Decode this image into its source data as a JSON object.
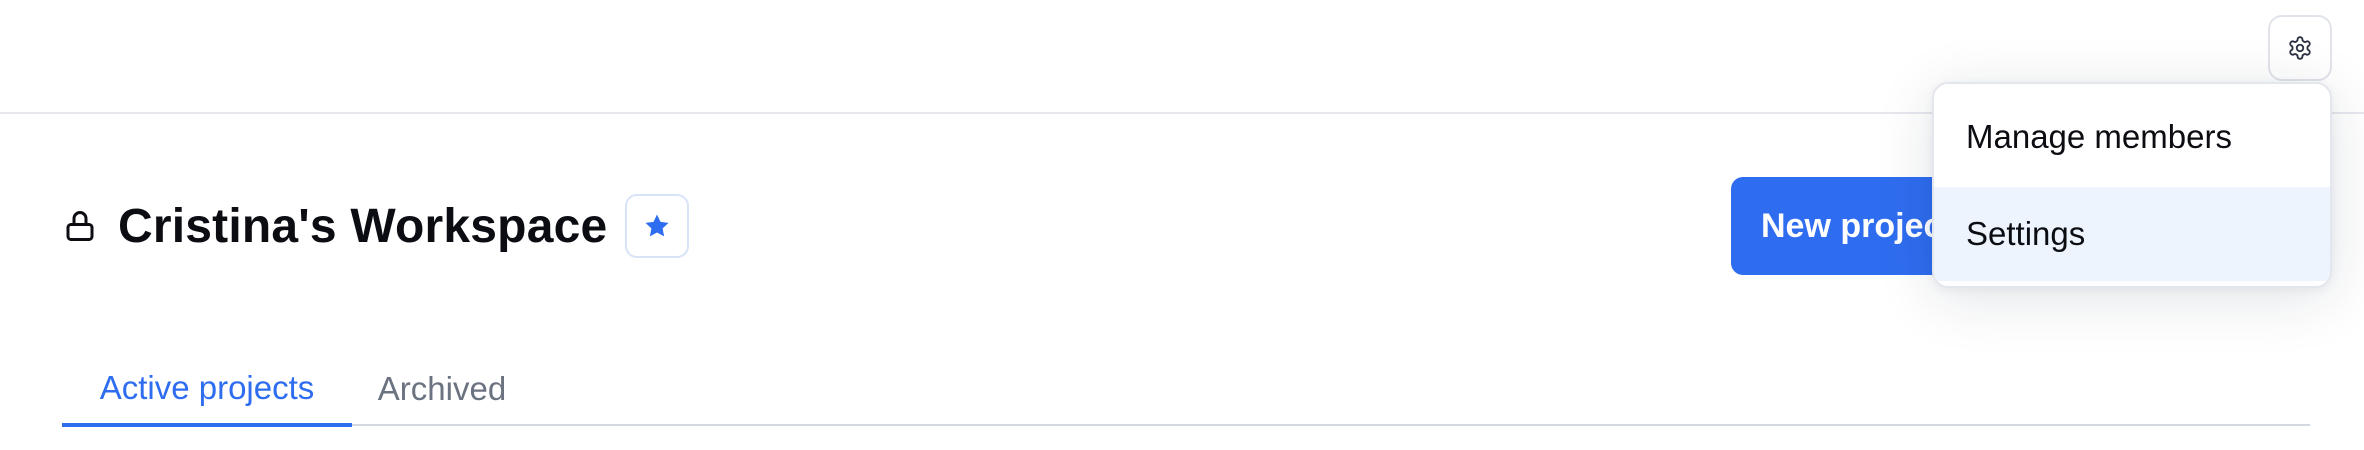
{
  "header": {
    "settings_icon": "gear-icon"
  },
  "workspace": {
    "lock_icon": "lock-icon",
    "title": "Cristina's Workspace",
    "star_icon": "star-icon",
    "star_color": "#2f6df0"
  },
  "actions": {
    "new_project_label": "New project"
  },
  "tabs": [
    {
      "label": "Active projects",
      "active": true
    },
    {
      "label": "Archived",
      "active": false
    }
  ],
  "dropdown": {
    "items": [
      {
        "label": "Manage members"
      },
      {
        "label": "Settings",
        "highlighted": true
      }
    ]
  },
  "colors": {
    "accent": "#2f6df0",
    "menu_highlight": "#eef4fd"
  }
}
